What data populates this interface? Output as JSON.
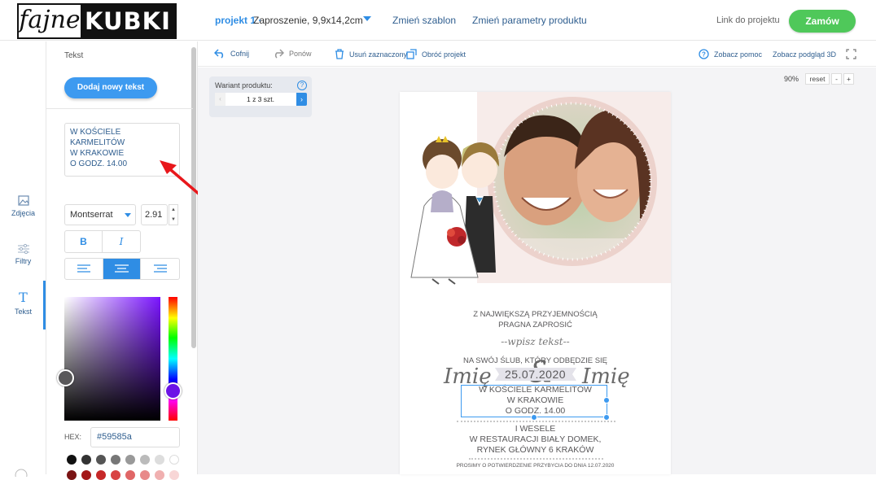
{
  "header": {
    "logo_left": "fajne",
    "logo_right": "KUBKI",
    "project_name": "projekt 1 ·",
    "project_size": "Zaproszenie, 9,9x14,2cm",
    "change_template": "Zmień szablon",
    "change_params": "Zmień parametry produktu",
    "link_label": "Link do projektu",
    "order_label": "Zamów"
  },
  "toolbar": {
    "undo": "Cofnij",
    "redo": "Ponów",
    "delete": "Usuń zaznaczony",
    "rotate": "Obróć projekt",
    "help": "Zobacz pomoc",
    "preview3d": "Zobacz podgląd 3D"
  },
  "iconbar": {
    "photos": "Zdjęcia",
    "filters": "Filtry",
    "text": "Tekst"
  },
  "panel": {
    "title": "Tekst",
    "add_text": "Dodaj nowy tekst",
    "textarea_value": "W KOŚCIELE\nKARMELITÓW\nW KRAKOWIE\nO GODZ. 14.00",
    "font": "Montserrat",
    "font_size": "2.91",
    "bold": "B",
    "italic": "I",
    "hex_label": "HEX:",
    "hex_value": "#59585a",
    "swatches": [
      "#111111",
      "#333333",
      "#555555",
      "#777777",
      "#999999",
      "#bbbbbb",
      "#dddddd",
      "#ffffff"
    ],
    "swatches2": [
      "#7a1414",
      "#a31616",
      "#c62828",
      "#d84343",
      "#e06666",
      "#e88a8a",
      "#f0b0b0",
      "#f8d6d6"
    ]
  },
  "variant": {
    "label": "Wariant produktu:",
    "help": "?",
    "prev": "‹",
    "value": "1 z 3 szt.",
    "next": "›"
  },
  "zoom": {
    "value": "90%",
    "reset": "reset",
    "minus": "-",
    "plus": "+"
  },
  "card": {
    "name1": "Imię",
    "amp": "&",
    "name2": "Imię",
    "line1": "Z NAJWIĘKSZĄ PRZYJEMNOŚCIĄ",
    "line2": "PRAGNA ZAPROSIĆ",
    "placeholder": "--wpisz tekst--",
    "line3": "NA SWÓJ ŚLUB, KTÓRY ODBĘDZIE SIĘ",
    "date": "25.07.2020",
    "sel1": "W KOŚCIELE KARMELITÓW",
    "sel2": "W KRAKOWIE",
    "sel3": "O GODZ. 14.00",
    "w1": "I WESELE",
    "w2": "W RESTAURACJI BIAŁY DOMEK,",
    "w3": "RYNEK GŁÓWNY 6 KRAKÓW",
    "rsvp": "PROSIMY O POTWIERDZENIE PRZYBYCIA DO DNIA 12.07.2020"
  },
  "colors": {
    "accent": "#2f8de4",
    "order_green": "#4fc85a",
    "text_color": "#59585a",
    "arrow_red": "#e8171b"
  }
}
